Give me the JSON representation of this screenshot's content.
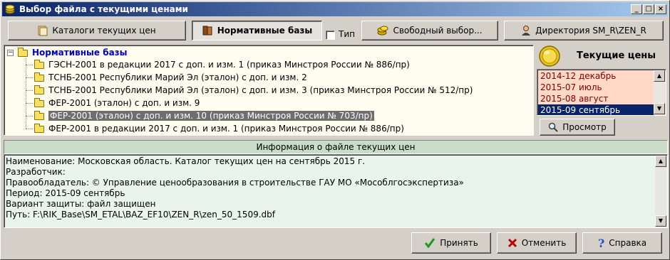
{
  "window": {
    "title": "Выбор файла с текущими ценами",
    "min": "_",
    "max": "□",
    "close": "×"
  },
  "toolbar": {
    "catalogs": "Каталоги текущих цен",
    "normative": "Нормативные базы",
    "type_label": "Тип",
    "free_select": "Свободный выбор...",
    "directory": "Директория SM_R\\ZEN_R"
  },
  "tree": {
    "root": "Нормативные базы",
    "items": [
      "ГЭСН-2001 в редакции 2017 с доп. и изм. 1 (приказ Минстроя России № 886/пр)",
      "ТСНБ-2001 Республики Марий Эл (эталон) с доп. и изм. 2",
      "ТСНБ-2001 Республики Марий Эл (эталон) с доп. и изм. 3 (приказ Минстроя России № 512/пр)",
      "ФЕР-2001 (эталон) с доп. и изм.  9",
      "ФЕР-2001 (эталон) с доп. и изм. 10 (приказ Минстроя России № 703/пр)",
      "ФЕР-2001 в редакции 2017 с доп. и изм. 1 (приказ Минстроя России № 886/пр)"
    ]
  },
  "prices": {
    "title": "Текущие цены",
    "items": [
      "2014-12 декабрь",
      "2015-07 июль",
      "2015-08 август",
      "2015-09 сентябрь"
    ],
    "view_button": "Просмотр"
  },
  "info": {
    "header": "Информация о файле текущих цен",
    "lines": [
      "Наименование: Московская область. Каталог текущих цен на сентябрь 2015 г.",
      "Разработчик:",
      "Правообладатель: © Управление ценообразования в строительстве ГАУ МО «Мособлгосэкспертиза»",
      "Период: 2015-09 сентябрь",
      "Вариант защиты: файл защищен",
      "Путь: F:\\RIK_Base\\SM_ETAL\\BAZ_EF10\\ZEN_R\\zen_50_1509.dbf"
    ]
  },
  "buttons": {
    "accept": "Принять",
    "cancel": "Отменить",
    "help": "Справка"
  },
  "colors": {
    "title_from": "#0a246a",
    "title_to": "#a6caf0",
    "accept_icon": "#1a9a1a",
    "cancel_icon": "#c00000",
    "help_icon": "#1a4fd0"
  }
}
